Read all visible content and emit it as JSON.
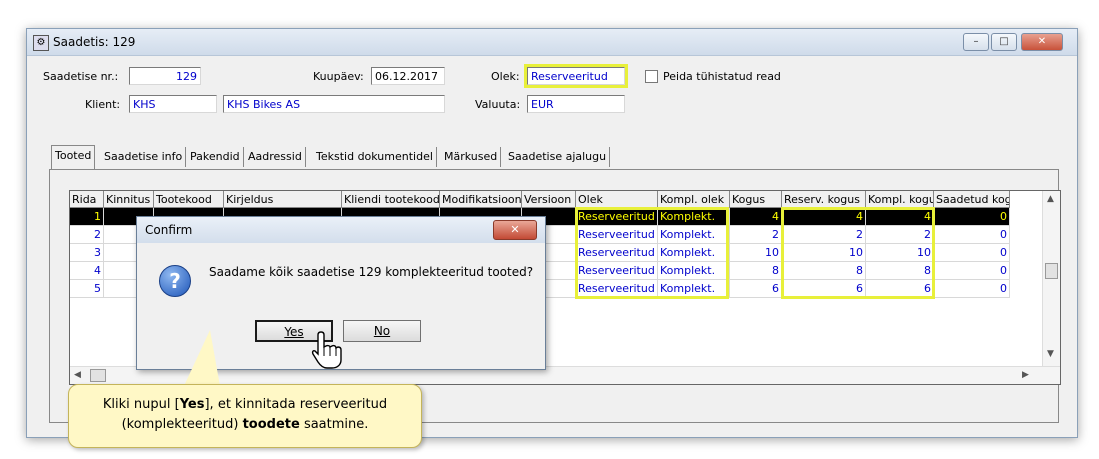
{
  "window": {
    "title": "Saadetis: 129",
    "minimize": "–",
    "maximize": "□",
    "close": "✕"
  },
  "form": {
    "shipment_no_label": "Saadetise nr.:",
    "shipment_no": "129",
    "date_label": "Kuupäev:",
    "date": "06.12.2017",
    "status_label": "Olek:",
    "status": "Reserveeritud",
    "hide_cancelled_label": "Peida tühistatud read",
    "client_label": "Klient:",
    "client_code": "KHS",
    "client_name": "KHS Bikes AS",
    "currency_label": "Valuuta:",
    "currency": "EUR"
  },
  "tabs": [
    {
      "label": "Tooted"
    },
    {
      "label": "Saadetise info"
    },
    {
      "label": "Pakendid"
    },
    {
      "label": "Aadressid"
    },
    {
      "label": "Tekstid dokumentidel"
    },
    {
      "label": "Märkused"
    },
    {
      "label": "Saadetise ajalugu"
    }
  ],
  "grid": {
    "columns": [
      "Rida",
      "Kinnitus",
      "Tootekood",
      "Kirjeldus",
      "Kliendi tootekood",
      "Modifikatsioon",
      "Versioon",
      "Olek",
      "Kompl. olek",
      "Kogus",
      "Reserv. kogus",
      "Kompl. kogus",
      "Saadetud kog"
    ],
    "rows": [
      {
        "rida": "1",
        "olek": "Reserveeritud",
        "kompl_olek": "Komplekt.",
        "kogus": "4",
        "reserv": "4",
        "kompl": "4",
        "saadetud": "0"
      },
      {
        "rida": "2",
        "olek": "Reserveeritud",
        "kompl_olek": "Komplekt.",
        "kogus": "2",
        "reserv": "2",
        "kompl": "2",
        "saadetud": "0"
      },
      {
        "rida": "3",
        "olek": "Reserveeritud",
        "kompl_olek": "Komplekt.",
        "kogus": "10",
        "reserv": "10",
        "kompl": "10",
        "saadetud": "0"
      },
      {
        "rida": "4",
        "olek": "Reserveeritud",
        "kompl_olek": "Komplekt.",
        "kogus": "8",
        "reserv": "8",
        "kompl": "8",
        "saadetud": "0"
      },
      {
        "rida": "5",
        "olek": "Reserveeritud",
        "kompl_olek": "Komplekt.",
        "kogus": "6",
        "reserv": "6",
        "kompl": "6",
        "saadetud": "0"
      }
    ]
  },
  "dialog": {
    "title": "Confirm",
    "close": "✕",
    "icon": "question-icon",
    "message": "Saadame kõik saadetise 129 komplekteeritud tooted?",
    "yes_label": "Yes",
    "no_label": "No"
  },
  "callout": {
    "text_before": "Kliki nupul [",
    "yes_word": "Yes",
    "text_middle": "], et kinnitada reserveeritud (komplekteeritud) ",
    "bold_word": "toodete",
    "text_after": " saatmine."
  },
  "colors": {
    "highlight": "#e8f03a",
    "field_text": "#0000cc",
    "selected_row_bg": "#000000",
    "selected_row_text": "#ffff00",
    "callout_bg": "#fff8c6"
  }
}
